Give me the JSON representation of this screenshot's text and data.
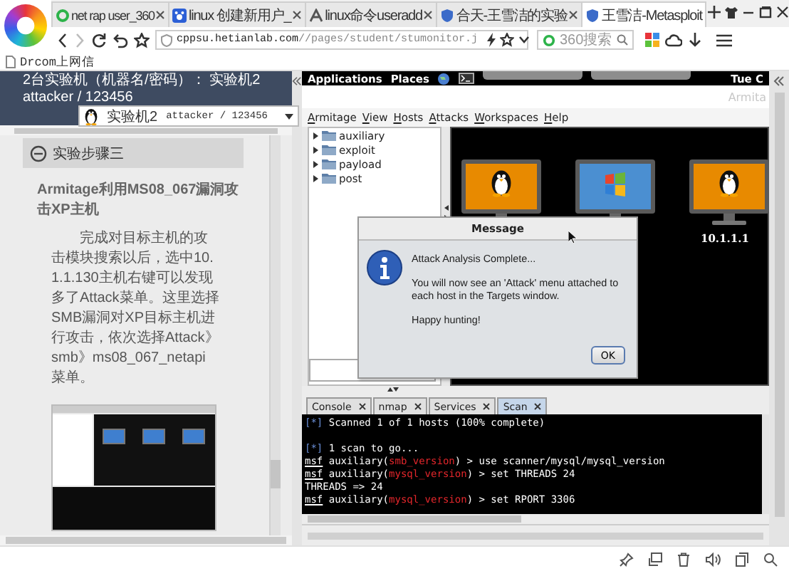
{
  "browser": {
    "tabs": [
      {
        "label": "net rap user_360",
        "selected": false
      },
      {
        "label": "linux 创建新用户_",
        "selected": false
      },
      {
        "label": "linux命令useradd",
        "selected": false
      },
      {
        "label": "合天-王雪洁的实验",
        "selected": false
      },
      {
        "label": "王雪洁-Metasploit",
        "selected": true
      }
    ],
    "address": {
      "host": "cppsu.hetianlab.com",
      "path": "//pages/student/stumonitor.j"
    },
    "search": {
      "placeholder": "360搜索"
    },
    "bookmarks": [
      "Drcom上网信"
    ]
  },
  "lab_panel": {
    "machines_text": "2台实验机（机器名/密码）： 实验机2　attacker / 123456",
    "machine_select": {
      "name": "实验机2",
      "credentials": "attacker / 123456"
    },
    "step": {
      "title": "实验步骤三",
      "expanded": true,
      "heading": "Armitage利用MS08_067漏洞攻击XP主机",
      "paragraph": "完成对目标主机的攻击模块搜索以后，选中10.1.1.130主机右键可以发现多了Attack菜单。这里选择SMB漏洞对XP目标主机进行攻击，依次选择Attack》smb》ms08_067_netapi菜单。"
    }
  },
  "vm": {
    "top_bar": {
      "menus": [
        "Applications",
        "Places"
      ],
      "clock": "Tue C"
    },
    "armitage": {
      "title": "Armita",
      "menu": [
        "Armitage",
        "View",
        "Hosts",
        "Attacks",
        "Workspaces",
        "Help"
      ],
      "modules": [
        {
          "label": "auxiliary",
          "expanded": false
        },
        {
          "label": "exploit",
          "expanded": false
        },
        {
          "label": "payload",
          "expanded": false
        },
        {
          "label": "post",
          "expanded": false
        }
      ],
      "hosts": [
        {
          "kind": "linux"
        },
        {
          "kind": "windows"
        },
        {
          "kind": "linux",
          "label": "10.1.1.1"
        }
      ],
      "tabs": [
        {
          "label": "Console",
          "selected": false
        },
        {
          "label": "nmap",
          "selected": false
        },
        {
          "label": "Services",
          "selected": false
        },
        {
          "label": "Scan",
          "selected": true
        }
      ],
      "console": [
        {
          "kind": "info",
          "marker": "[*]",
          "text": " Scanned 1 of 1 hosts (100% complete)"
        },
        {
          "kind": "blank"
        },
        {
          "kind": "info",
          "marker": "[*]",
          "text": " 1 scan to go..."
        },
        {
          "kind": "prompt",
          "prompt": "msf",
          "context": " auxiliary(",
          "module": "smb_version",
          "command": ") > use scanner/mysql/mysql_version"
        },
        {
          "kind": "prompt",
          "prompt": "msf",
          "context": " auxiliary(",
          "module": "mysql_version",
          "command": ") > set THREADS 24"
        },
        {
          "kind": "plain",
          "text": "THREADS => 24"
        },
        {
          "kind": "prompt",
          "prompt": "msf",
          "context": " auxiliary(",
          "module": "mysql_version",
          "command": ") > set RPORT 3306"
        }
      ]
    },
    "dialog": {
      "title": "Message",
      "lines": [
        "Attack Analysis Complete...",
        "You will now see an 'Attack' menu attached to each host in the Targets window.",
        "Happy hunting!"
      ],
      "button": "OK"
    }
  }
}
